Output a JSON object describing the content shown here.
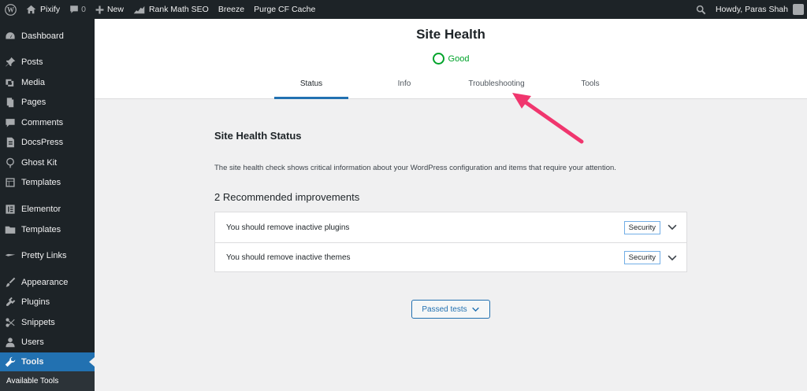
{
  "admin_bar": {
    "site_name": "Pixify",
    "comments_count": "0",
    "new_label": "New",
    "seo_label": "Rank Math SEO",
    "breeze_label": "Breeze",
    "purge_label": "Purge CF Cache",
    "greeting": "Howdy, Paras Shah"
  },
  "sidebar": {
    "items": [
      {
        "label": "Dashboard",
        "icon": "dashboard-icon"
      },
      {
        "label": "Posts",
        "icon": "pin-icon"
      },
      {
        "label": "Media",
        "icon": "media-icon"
      },
      {
        "label": "Pages",
        "icon": "pages-icon"
      },
      {
        "label": "Comments",
        "icon": "comment-icon"
      },
      {
        "label": "DocsPress",
        "icon": "document-icon"
      },
      {
        "label": "Ghost Kit",
        "icon": "ghost-icon"
      },
      {
        "label": "Templates",
        "icon": "templates-icon"
      },
      {
        "label": "Elementor",
        "icon": "elementor-icon"
      },
      {
        "label": "Templates",
        "icon": "folder-icon"
      },
      {
        "label": "Pretty Links",
        "icon": "link-icon"
      },
      {
        "label": "Appearance",
        "icon": "brush-icon"
      },
      {
        "label": "Plugins",
        "icon": "plugin-icon"
      },
      {
        "label": "Snippets",
        "icon": "snippets-icon"
      },
      {
        "label": "Users",
        "icon": "user-icon"
      },
      {
        "label": "Tools",
        "icon": "wrench-icon"
      }
    ],
    "submenu_label": "Available Tools"
  },
  "header": {
    "title": "Site Health",
    "status": "Good",
    "tabs": [
      {
        "label": "Status"
      },
      {
        "label": "Info"
      },
      {
        "label": "Troubleshooting"
      },
      {
        "label": "Tools"
      }
    ]
  },
  "main": {
    "section_title": "Site Health Status",
    "description": "The site health check shows critical information about your WordPress configuration and items that require your attention.",
    "recommended_heading": "2 Recommended improvements",
    "issues": [
      {
        "label": "You should remove inactive plugins",
        "badge": "Security"
      },
      {
        "label": "You should remove inactive themes",
        "badge": "Security"
      }
    ],
    "passed_button": "Passed tests"
  },
  "colors": {
    "accent": "#2271b1",
    "good": "#00a32a",
    "arrow": "#f0366e",
    "admin_dark": "#1d2327"
  }
}
